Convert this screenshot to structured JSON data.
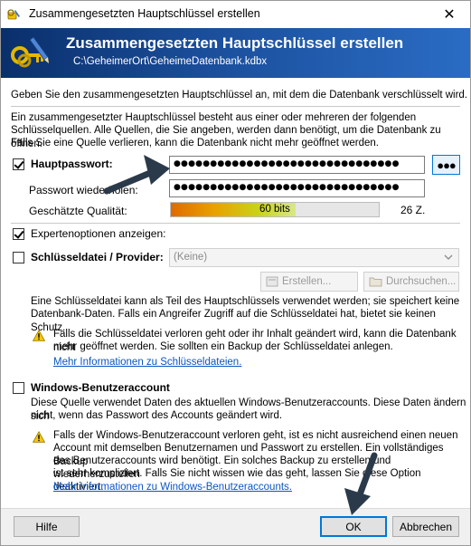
{
  "window": {
    "title": "Zusammengesetzten Hauptschlüssel erstellen",
    "close_glyph": "✕"
  },
  "banner": {
    "heading": "Zusammengesetzten Hauptschlüssel erstellen",
    "path": "C:\\GeheimerOrt\\GeheimeDatenbank.kdbx",
    "icon": "keys-pen-icon"
  },
  "intro": {
    "line1": "Geben Sie den zusammengesetzten Hauptschlüssel an, mit dem die Datenbank verschlüsselt wird.",
    "para_line1": "Ein zusammengesetzter Hauptschlüssel besteht aus einer oder mehreren der folgenden",
    "para_line2": "Schlüsselquellen. Alle Quellen, die Sie angeben, werden dann benötigt, um die Datenbank zu öffnen.",
    "para_line3": "Falls Sie eine Quelle verlieren, kann die Datenbank nicht mehr geöffnet werden."
  },
  "master_password": {
    "label": "Hauptpasswort:",
    "checked": true,
    "value": "●●●●●●●●●●●●●●●●●●●●●●●●●●●●●●●",
    "repeat_label": "Passwort wiederholen:",
    "repeat_value": "●●●●●●●●●●●●●●●●●●●●●●●●●●●●●●●",
    "toggle_label": "●●●",
    "quality_label": "Geschätzte Qualität:",
    "quality_text": "60 bits",
    "quality_fraction": 0.6,
    "char_count": "26 Z."
  },
  "expert": {
    "label": "Expertenoptionen anzeigen:",
    "checked": true
  },
  "keyfile": {
    "label": "Schlüsseldatei / Provider:",
    "checked": false,
    "select_value": "(Keine)",
    "create_label": "Erstellen...",
    "browse_label": "Durchsuchen...",
    "desc_line1": "Eine Schlüsseldatei kann als Teil des Hauptschlüssels verwendet werden; sie speichert keine",
    "desc_line2": "Datenbank-Daten. Falls ein Angreifer Zugriff auf die Schlüsseldatei hat, bietet sie keinen Schutz.",
    "warn_line1": "Falls die Schlüsseldatei verloren geht oder ihr Inhalt geändert wird, kann die Datenbank nicht",
    "warn_line2": "mehr geöffnet werden. Sie sollten ein Backup der Schlüsseldatei anlegen.",
    "link": "Mehr Informationen zu Schlüsseldateien."
  },
  "windows_account": {
    "label": "Windows-Benutzeraccount",
    "checked": false,
    "desc_line1": "Diese Quelle verwendet Daten des aktuellen Windows-Benutzeraccounts. Diese Daten ändern sich",
    "desc_line2": "nicht, wenn das Passwort des Accounts geändert wird.",
    "warn_line1": "Falls der Windows-Benutzeraccount verloren geht, ist es nicht ausreichend einen neuen",
    "warn_line2": "Account mit demselben Benutzernamen und Passwort zu erstellen. Ein vollständiges Backup",
    "warn_line3": "des Benutzeraccounts wird benötigt. Ein solches Backup zu erstellen und wiederherzustellen",
    "warn_line4": "ist sehr kompliziert. Falls Sie nicht wissen wie das geht, lassen Sie diese Option deaktiviert.",
    "link": "Mehr Informationen zu Windows-Benutzeraccounts."
  },
  "footer": {
    "help_label": "Hilfe",
    "ok_label": "OK",
    "cancel_label": "Abbrechen"
  },
  "colors": {
    "banner_dark": "#0a2f6b",
    "banner_light": "#2a6cc4",
    "link": "#0b55c4",
    "arrow": "#2b3a4a",
    "focus_blue": "#0078d7"
  }
}
